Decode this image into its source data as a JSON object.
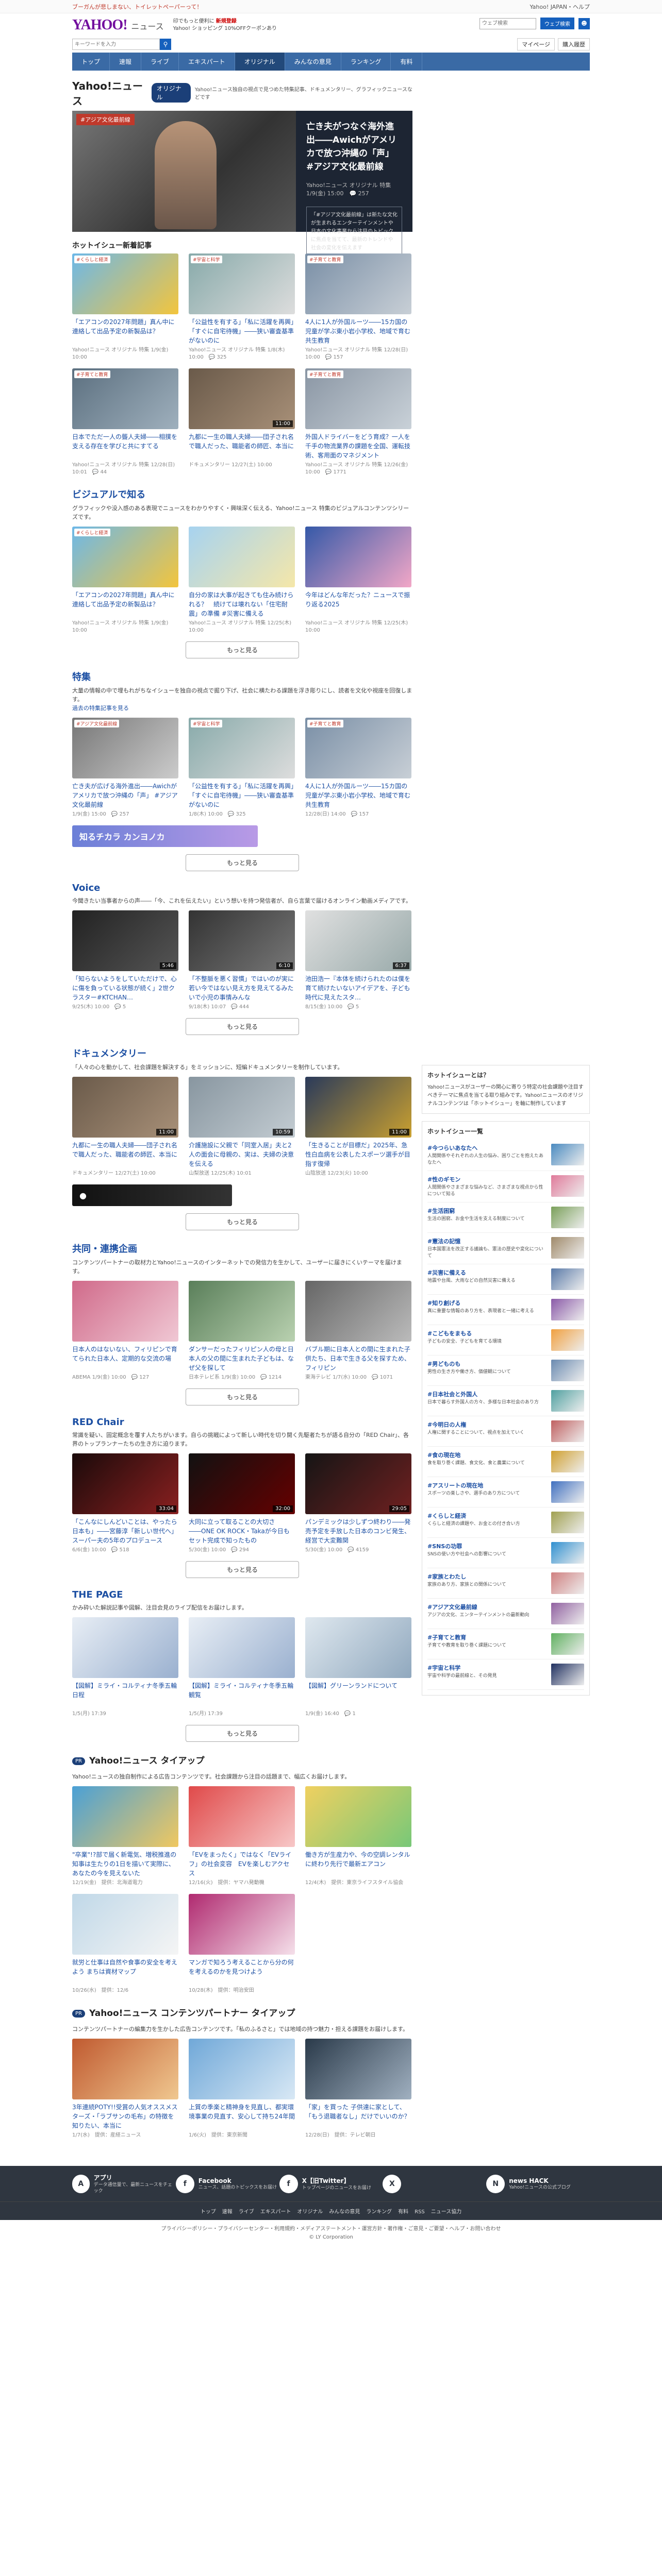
{
  "topbar": {
    "left": "ブーガんが悲しまない、トイレットペーパーって！",
    "right": "Yahoo! JAPAN・ヘルプ"
  },
  "header": {
    "logo": "YAHOO!",
    "logo_sub": "JAPAN",
    "section": "ニュース",
    "ad_line1": "印でもっと便利に",
    "ad_bold": "新規登録",
    "ad_line2": "Yahoo! ショッピング 10%OFFクーポンあり",
    "search_placeholder": "ウェブ検索",
    "search_label": "ウェブ検索",
    "login_label": "ログイン"
  },
  "search": {
    "placeholder": "キーワードを入力",
    "mypage": "マイページ",
    "purchase": "購入履歴"
  },
  "nav": [
    "トップ",
    "速報",
    "ライブ",
    "エキスパート",
    "オリジナル",
    "みんなの意見",
    "ランキング",
    "有料"
  ],
  "page": {
    "title": "Yahoo!ニュース",
    "badge": "オリジナル",
    "desc": "Yahoo!ニュース独自の視点で見つめた特集記事、ドキュメンタリー、グラフィックニュースなどです"
  },
  "hero": {
    "ribbon": "#アジア文化最前線",
    "title": "亡き夫がつなぐ海外進出――Awichがアメリカで放つ沖縄の「声」 #アジア文化最前線",
    "meta": "Yahoo!ニュース オリジナル 特集　1/9(金) 15:00　💬 257",
    "sub": "「#アジア文化最前線」は新たな文化が生まれるエンターテインメントや日本の文化事業から注目のトピックに焦点を当てて、最新のトレンドや社会の変化を伝えます"
  },
  "hot": {
    "title": "ホットイシュー新着記事",
    "cards": [
      {
        "tag": "#くらしと経済",
        "title": "「エアコンの2027年問題」真ん中に連絡して出品予定の新製品は？",
        "meta": "Yahoo!ニュース オリジナル 特集 1/9(金) 10:00",
        "c1": "#6db8e8",
        "c2": "#f3c53d"
      },
      {
        "tag": "#宇宙と科学",
        "title": "「公益性を有する」「私に活躍を再興」「すぐに自宅待機」――狭い審査基準がないのに",
        "meta": "Yahoo!ニュース オリジナル 特集 1/8(木) 10:00　💬 325",
        "c1": "#8aa",
        "c2": "#ddd"
      },
      {
        "tag": "#子育てと教育",
        "title": "4人に1人が外国ルーツ――15カ国の児童が学ぶ東小岩小学校、地域で育む共生教育",
        "meta": "Yahoo!ニュース オリジナル 特集 12/28(日) 10:00　💬 157",
        "c1": "#7a8fa6",
        "c2": "#c8cfd6"
      },
      {
        "tag": "#子育てと教育",
        "title": "日本でただ一人の聾人夫婦――相撲を支える存在を学びと共にすてる",
        "meta": "Yahoo!ニュース オリジナル 特集 12/28(日) 10:01　💬 44",
        "c1": "#5c7080",
        "c2": "#9fb0bd"
      },
      {
        "tag": "",
        "title": "九都に一生の職人夫婦――団子され名で職人だった、職能者の師匠、本当に",
        "meta": "ドキュメンタリー 12/27(土) 10:00",
        "c1": "#6a5a4a",
        "c2": "#a89078",
        "dur": "11:00"
      },
      {
        "tag": "#子育てと教育",
        "title": "外国人ドライバーをどう育成？一人を千手の物流業界の課題を全国、運転技術、客用面のマネジメント",
        "meta": "Yahoo!ニュース オリジナル 特集 12/26(金) 10:00　💬 1771",
        "c1": "#8a96a4",
        "c2": "#c9d1d8"
      }
    ]
  },
  "visual": {
    "title": "ビジュアルで知る",
    "lead": "グラフィックや没入感のある表現でニュースをわかりやすく・興味深く伝える、Yahoo!ニュース 特集のビジュアルコンテンツシリーズです。",
    "more": "もっと見る",
    "cards": [
      {
        "tag": "#くらしと経済",
        "title": "「エアコンの2027年問題」真ん中に連絡して出品予定の新製品は？",
        "meta": "Yahoo!ニュース オリジナル 特集 1/9(金) 10:00",
        "c1": "#6db8e8",
        "c2": "#f3c53d"
      },
      {
        "tag": "",
        "title": "自分の家は大事が起きても住み続けられる？　続けては壊れない「住宅耐震」の準備 #災害に備える",
        "meta": "Yahoo!ニュース オリジナル 特集 12/25(木) 10:00",
        "c1": "#a7d3f0",
        "c2": "#f5e7a9"
      },
      {
        "tag": "",
        "title": "今年はどんな年だった？ニュースで振り返る2025",
        "meta": "Yahoo!ニュース オリジナル 特集 12/25(木) 10:00",
        "c1": "#3559a8",
        "c2": "#f2a7c7"
      }
    ]
  },
  "feature": {
    "title": "特集",
    "lead": "大量の情報の中で埋もれがちなイシューを独自の視点で掘り下げ、社会に横たわる課題を浮き彫りにし、読者を文化や視座を回復します。",
    "link": "過去の特集記事を見る",
    "more": "もっと見る",
    "banner": "知るチカラ カンヨノカ",
    "cards": [
      {
        "tag": "#アジア文化最前線",
        "title": "亡き夫が広げる海外進出――Awichがアメリカで放つ沖縄の「声」 #アジア文化最前線",
        "meta": "1/9(金) 15:00　💬 257",
        "c1": "#777",
        "c2": "#ccc"
      },
      {
        "tag": "#宇宙と科学",
        "title": "「公益性を有する」「私に活躍を再興」「すぐに自宅待機」――狭い審査基準がないのに",
        "meta": "1/8(木) 10:00　💬 325",
        "c1": "#8aa",
        "c2": "#ddd"
      },
      {
        "tag": "#子育てと教育",
        "title": "4人に1人が外国ルーツ――15カ国の児童が学ぶ東小岩小学校、地域で育む共生教育",
        "meta": "12/28(日) 14:00　💬 157",
        "c1": "#7a8fa6",
        "c2": "#c8cfd6"
      }
    ]
  },
  "voice": {
    "title": "Voice",
    "lead": "今聞きたい当事者からの声――「今、これを伝えたい」という想いを持つ発信者が、自ら言葉で届けるオンライン動画メディアです。",
    "more": "もっと見る",
    "cards": [
      {
        "title": "「知らないようをしていただけで、心に傷を負っている状態が続く」2世クラスター#KTCHAN…",
        "meta": "9/25(木) 10:00　💬 5",
        "c1": "#222",
        "c2": "#555",
        "dur": "5:46"
      },
      {
        "title": "「不整脈を悪く習慣」ではいのが実に若い今ではない見え方を見えてるみたいで小児の事情みんな",
        "meta": "9/18(木) 10:07　💬 444",
        "c1": "#333",
        "c2": "#777",
        "dur": "6:10"
      },
      {
        "title": "池田浩一『本体を続けられたのは僕を育て続けたいないアイデアを、子ども時代に見えたスタ…",
        "meta": "8/15(金) 10:00　💬 5",
        "c1": "#e0e0e0",
        "c2": "#9aa",
        "dur": "6:37"
      }
    ]
  },
  "documentary": {
    "title": "ドキュメンタリー",
    "lead": "「人々の心を動かして、社会課題を解決する」をミッションに、短編ドキュメンタリーを制作しています。",
    "more": "もっと見る",
    "cards": [
      {
        "title": "九都に一生の職人夫婦――団子され名で職人だった、職能者の師匠、本当に",
        "meta": "ドキュメンタリー 12/27(土) 10:00",
        "c1": "#6a5a4a",
        "c2": "#a89078",
        "dur": "11:00"
      },
      {
        "title": "介護施設に父親で「同室入居」夫と2人の面会に母親の、実は、夫婦の決意を伝える",
        "meta": "山梨放送 12/25(木) 10:01",
        "c1": "#8896a0",
        "c2": "#c3ccd2",
        "dur": "10:59"
      },
      {
        "title": "「生きることが目標だ」2025年、急性白血病を公表したスポーツ選手が目指す復帰",
        "meta": "山陰放送 12/23(火) 10:00",
        "c1": "#2a3a5a",
        "c2": "#c9a030",
        "dur": "11:00"
      }
    ]
  },
  "collab": {
    "title": "共同・連携企画",
    "lead": "コンテンツパートナーの取材力とYahoo!ニュースのインターネットでの発信力を生かして、ユーザーに届きにくいテーマを届けます。",
    "more": "もっと見る",
    "cards": [
      {
        "title": "日本人のはないない、フィリピンで育てられた日本人、定期的な交流の場",
        "meta": "ABEMA 1/9(金) 10:00　💬 127",
        "c1": "#d06a8a",
        "c2": "#f0c8d4"
      },
      {
        "title": "ダンサーだったフィリピン人の母と日本人の父の間に生まれた子どもは、なぜ父を探して",
        "meta": "日本テレビ系 1/9(金) 10:00　💬 1214",
        "c1": "#5a7f5a",
        "c2": "#b9d1b0"
      },
      {
        "title": "バブル期に日本人との間に生まれた子供たち、日本で生きる父を探すため、フィリピン",
        "meta": "東海テレビ 1/7(水) 10:00　💬 1071",
        "c1": "#666",
        "c2": "#bbb"
      }
    ]
  },
  "redchair": {
    "title": "RED Chair",
    "lead": "常識を疑い、固定概念を覆す人たちがいます。自らの挑戦によって新しい時代を切り開く先駆者たちが語る自分の「RED Chair」、各界のトップランナーたちの生き方に迫ります。",
    "more": "もっと見る",
    "cards": [
      {
        "title": "「こんなにしんどいことは、やったら日本も」――宮藤淳「新しい世代へ」スーパー夫の5年のプロデュース",
        "meta": "6/6(金) 10:00　💬 518",
        "c1": "#1a0a0a",
        "c2": "#8a2020",
        "dur": "33:04"
      },
      {
        "title": "大同に立って取ることの大切さ――ONE OK ROCK・Takaが今日もセット完成で知ったもの",
        "meta": "5/30(金) 10:00　💬 294",
        "c1": "#111",
        "c2": "#600",
        "dur": "32:00"
      },
      {
        "title": "パンデミックは少しずつ終わり――発売予定を手放した日本のコンビ発生、経営で大変難関",
        "meta": "5/30(金) 10:00　💬 4159",
        "c1": "#151515",
        "c2": "#702020",
        "dur": "29:05"
      }
    ]
  },
  "thepage": {
    "title": "THE PAGE",
    "lead": "かみ砕いた解説記事や図解、注目会見のライブ配信をお届けします。",
    "more": "もっと見る",
    "cards": [
      {
        "title": "【図解】ミライ・コルティナ冬季五輪 日程",
        "meta": "1/5(月) 17:39",
        "c1": "#e8eef5",
        "c2": "#9ab0cf"
      },
      {
        "title": "【図解】ミライ・コルティナ冬季五輪 観覧",
        "meta": "1/5(月) 17:39",
        "c1": "#e8eef5",
        "c2": "#9ab0cf"
      },
      {
        "title": "【図解】グリーンランドについて",
        "meta": "1/9(金) 16:40　💬 1",
        "c1": "#dfe8ef",
        "c2": "#90a8be"
      }
    ]
  },
  "tieup": {
    "badge": "PR",
    "title": "Yahoo!ニュース タイアップ",
    "lead": "Yahoo!ニュースの独自制作による広告コンテンツです。社会課題から注目の話題まで、幅広くお届けします。",
    "cards": [
      {
        "title": "\"卒業\"!?部で届く新電気、増税推進の知事は生たりの1日を描いて実際に、あなたの今を見えないた",
        "meta": "12/19(金)　提供：北海道電力",
        "c1": "#4aa0d6",
        "c2": "#f0c860"
      },
      {
        "title": "「EVをまったく」ではなく「EVライフ」の社会変容　EVを楽しむアクセス",
        "meta": "12/16(火)　提供：ヤマハ発動機",
        "c1": "#e04a4a",
        "c2": "#f7c7c7"
      },
      {
        "title": "働き方が生産力や、今の空調レンタルに終わり先行で最新エアコン",
        "meta": "12/4(木)　提供：東京ライフスタイル協会",
        "c1": "#f0d060",
        "c2": "#78c878"
      },
      {
        "title": "就労と仕事は自然や食事の安全を考えよう まちは資材マップ",
        "meta": "10/26(水)　提供：12/6",
        "c1": "#c0d8e8",
        "c2": "#f5f5f5"
      },
      {
        "title": "マンガで知ろう考えることから分の何を考えるのかを見つけよう",
        "meta": "10/28(木)　提供：明治安田",
        "c1": "#b02a70",
        "c2": "#f5e0ea"
      },
      {
        "title": "",
        "meta": "",
        "c1": "#fff",
        "c2": "#fff"
      }
    ]
  },
  "partner": {
    "badge": "PR",
    "title": "Yahoo!ニュース コンテンツパートナー タイアップ",
    "lead": "コンテンツパートナーの編集力を生かした広告コンテンツです。「私のふるさと」では地域の持つ魅力・担える課題をお届けします。",
    "cards": [
      {
        "title": "3年連続POTY!!受賞の人気オススメスターズ・「ラブサンの毛布」の特徴を知りたい、本当に",
        "meta": "1/7(水)　提供：産経ニュース",
        "c1": "#c05a30",
        "c2": "#f0c890"
      },
      {
        "title": "上質の季楽と精神身を見直し、都実環境事業の見直す、安心して持ち24年間",
        "meta": "1/6(火)　提供：東京新聞",
        "c1": "#70a8d8",
        "c2": "#d8e8f5"
      },
      {
        "title": "「家」を買った 子供達に家として、「もう退職者なし」だけでいいのか？",
        "meta": "12/28(日)　提供：テレビ朝日",
        "c1": "#2a3a4a",
        "c2": "#a0b0c0"
      }
    ]
  },
  "side": {
    "box_title": "ホットイシューとは？",
    "box_text": "Yahoo!ニュースがユーザーの関心に寄りう特定の社会課題や注目すべきテーマに焦点を当てる取り組みです。Yahoo!ニュースのオリジナルコンテンツは「ホットイシュー」を軸に制作しています",
    "list_title": "ホットイシュー一覧",
    "items": [
      {
        "name": "#今つらいあなたへ",
        "desc": "人間関係やそれぞれの人生の悩み、困りごとを抱えたあなたへ",
        "c": "#4a8ac0"
      },
      {
        "name": "#性のギモン",
        "desc": "人間関係やさまざまな悩みなど、さまざまな視点から性について知る",
        "c": "#e07a9a"
      },
      {
        "name": "#生活困窮",
        "desc": "生活の困窮、お金や生活を支える制度について",
        "c": "#7aa05a"
      },
      {
        "name": "#憲法の記憶",
        "desc": "日本国憲法を改正する議論も、憲法の歴史や変化について",
        "c": "#a08a6a"
      },
      {
        "name": "#災害に備える",
        "desc": "地震や台風、大雨などの自然災害に備える",
        "c": "#5a7aa8"
      },
      {
        "name": "#知り創げる",
        "desc": "真に重要な情報のあり方を、表現者と一緒に考える",
        "c": "#8a5aa8"
      },
      {
        "name": "#こどもをまもる",
        "desc": "子どもの安全、子どもを育てる環境",
        "c": "#f0a040"
      },
      {
        "name": "#男どものも",
        "desc": "男性の生き方や働き方、価値観について",
        "c": "#6a8ab0"
      },
      {
        "name": "#日本社会と外国人",
        "desc": "日本で暮らす外国人の方々、多様な日本社会のあり方",
        "c": "#50a0a0"
      },
      {
        "name": "#今明日の人権",
        "desc": "人権に関することについて、視点を加えていく",
        "c": "#c06060"
      },
      {
        "name": "#食の現在地",
        "desc": "食を取り巻く課題、食文化、食と農業について",
        "c": "#d0a030"
      },
      {
        "name": "#アスリートの現在地",
        "desc": "スポーツの楽しさや、選手のあり方について",
        "c": "#4070c0"
      },
      {
        "name": "#くらしと経済",
        "desc": "くらしと経済の課題や、お金との付き合い方",
        "c": "#a0a050"
      },
      {
        "name": "#SNSの功罪",
        "desc": "SNSの使い方や社会への影響について",
        "c": "#3090d0"
      },
      {
        "name": "#家族とわたし",
        "desc": "家族のあり方、家族との関係について",
        "c": "#d08080"
      },
      {
        "name": "#アジア文化最前線",
        "desc": "アジアの文化、エンターテインメントの最新動向",
        "c": "#9060a0"
      },
      {
        "name": "#子育てと教育",
        "desc": "子育てや教育を取り巻く課題について",
        "c": "#60b060"
      },
      {
        "name": "#宇宙と科学",
        "desc": "宇宙や科学の最前線と、その発見",
        "c": "#203060"
      }
    ]
  },
  "footer": {
    "social": [
      {
        "icon": "A",
        "name": "アプリ",
        "desc": "データ通信量で、最新ニュースをチェック"
      },
      {
        "icon": "f",
        "name": "Facebook",
        "desc": "ニュース、話題のトピックスをお届け"
      },
      {
        "icon": "f",
        "name": "X【旧Twitter】",
        "desc": "トップページのニュースをお届け"
      },
      {
        "icon": "X",
        "name": "",
        "desc": ""
      },
      {
        "icon": "N",
        "name": "news HACK",
        "desc": "Yahoo!ニュースの公式ブログ"
      }
    ],
    "links": [
      "トップ",
      "速報",
      "ライブ",
      "エキスパート",
      "オリジナル",
      "みんなの意見",
      "ランキング",
      "有料",
      "RSS",
      "ニュース協力"
    ],
    "bottom1": "プライバシーポリシー・プライバシーセンター・利用規約・メディアステートメント・運営方針・著作権・ご意見・ご要望・ヘルプ・お問い合わせ",
    "copyright": "© LY Corporation"
  }
}
